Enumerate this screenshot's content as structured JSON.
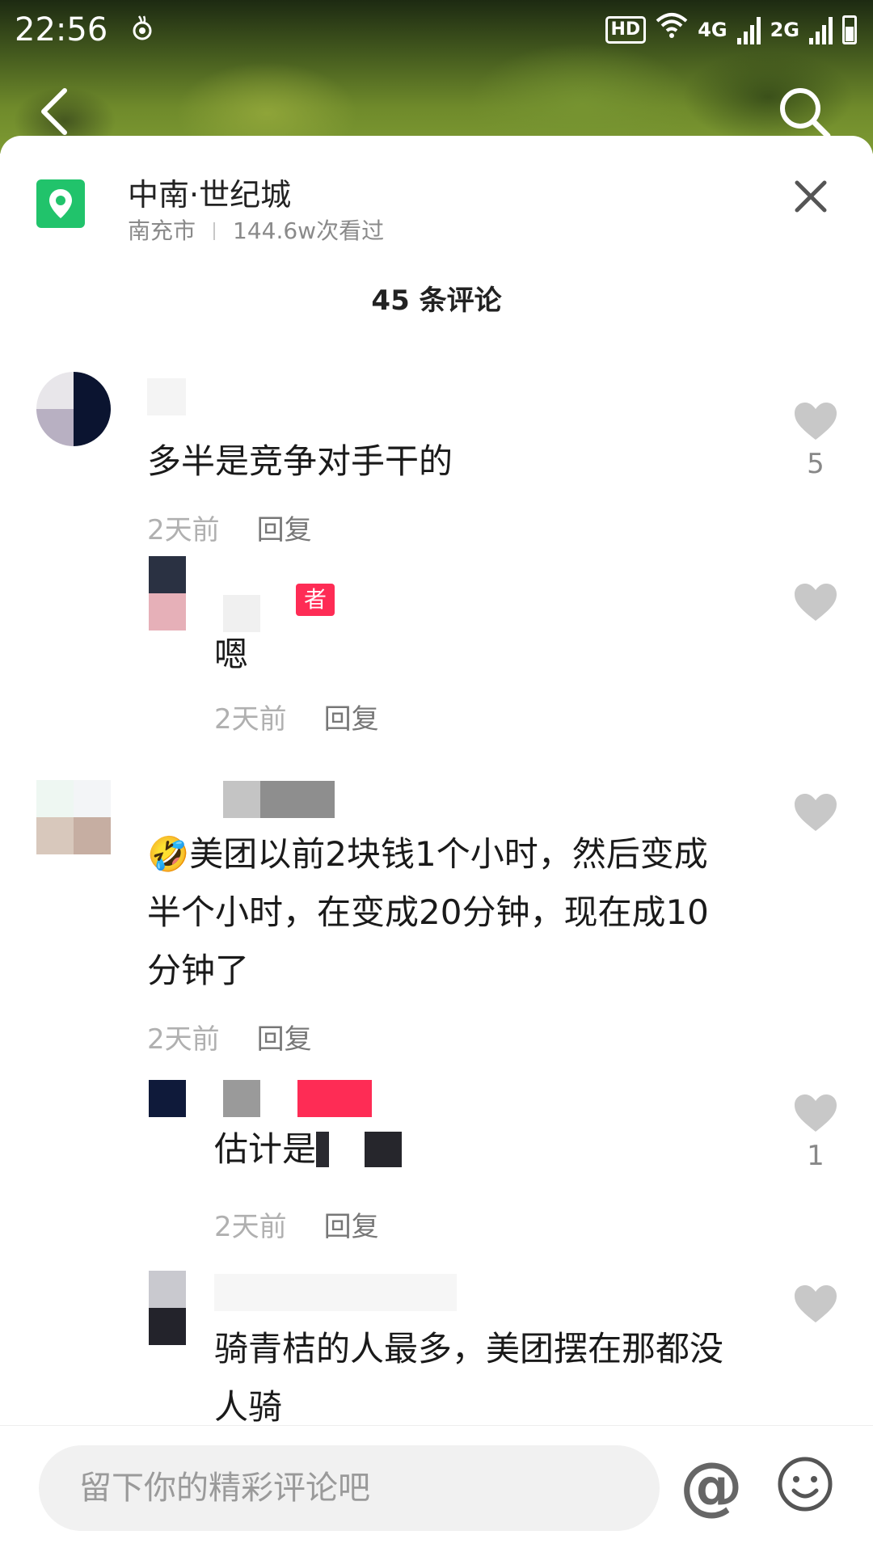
{
  "status_bar": {
    "time": "22:56",
    "hd_badge": "HD",
    "network_4g": "4G",
    "network_2g": "2G",
    "signal_1_label": "1",
    "signal_2_label": "2G"
  },
  "header": {
    "back_icon": "chevron-left-icon",
    "search_icon": "search-icon"
  },
  "location": {
    "title": "中南·世纪城",
    "city": "南充市",
    "views": "144.6w次看过",
    "icon": "location-pin-icon",
    "icon_color": "#21c36b"
  },
  "comments_header": {
    "count_text": "45 条评论"
  },
  "comments": [
    {
      "text": "多半是竞争对手干的",
      "time": "2天前",
      "reply_label": "回复",
      "likes": "5"
    },
    {
      "is_reply": true,
      "author_tag": "者",
      "text": "嗯",
      "time": "2天前",
      "reply_label": "回复",
      "likes": ""
    },
    {
      "emoji": "🤣",
      "text_line1": "美团以前2块钱1个小时，然后变成",
      "text_line2": "半个小时，在变成20分钟，现在成10",
      "text_line3": "分钟了",
      "time": "2天前",
      "reply_label": "回复",
      "likes": ""
    },
    {
      "is_reply": true,
      "text": "估计是",
      "time": "2天前",
      "reply_label": "回复",
      "likes": "1"
    },
    {
      "is_reply": true,
      "text_line1": "骑青桔的人最多，美团摆在那都没",
      "text_line2": "人骑",
      "likes": ""
    }
  ],
  "input_bar": {
    "placeholder": "留下你的精彩评论吧",
    "at_label": "@",
    "emoji_icon": "smiley-icon"
  },
  "colors": {
    "accent_red": "#fe2c55",
    "location_green": "#21c36b",
    "like_gray": "#c8c8c8"
  }
}
